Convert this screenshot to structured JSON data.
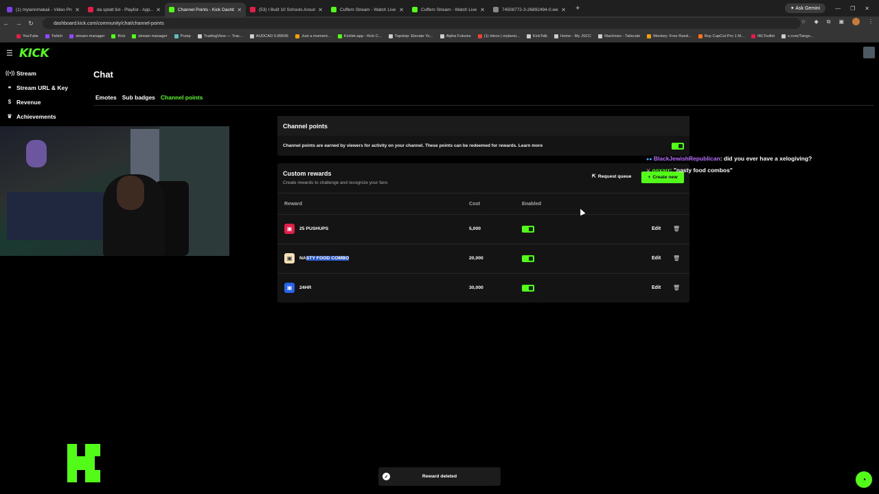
{
  "browser": {
    "tabs": [
      {
        "title": "(1) mylannmakaii - Video Prod...",
        "color": "#7b3fe4",
        "active": false
      },
      {
        "title": "da splatt list - Playlist - App...",
        "color": "#e11d48",
        "active": false
      },
      {
        "title": "Channel Points - Kick Dashbo...",
        "color": "#53fc18",
        "active": true
      },
      {
        "title": "(53) I Built 10 Schools Around...",
        "color": "#e11d48",
        "active": false
      },
      {
        "title": "Cuffem Stream - Watch Live o...",
        "color": "#53fc18",
        "active": false
      },
      {
        "title": "Cuffem Stream - Watch Live o...",
        "color": "#53fc18",
        "active": false
      },
      {
        "title": "74508772-3-26892494-0.webp",
        "color": "#888888",
        "active": false
      }
    ],
    "new_tab": "+",
    "ask_gemini": "Ask Gemini",
    "url": "dashboard.kick.com/community/chat/channel-points",
    "bookmarks": [
      {
        "label": "YouTube",
        "color": "#e11d48"
      },
      {
        "label": "Twitch",
        "color": "#9146ff"
      },
      {
        "label": "stream manager",
        "color": "#9146ff"
      },
      {
        "label": "Kick",
        "color": "#53fc18"
      },
      {
        "label": "stream manager",
        "color": "#53fc18"
      },
      {
        "label": "Pump",
        "color": "#5bc0be"
      },
      {
        "label": "TradingView — Trac...",
        "color": "#cccccc"
      },
      {
        "label": "AUDCAD 0.89596",
        "color": "#cccccc"
      },
      {
        "label": "Just a moment...",
        "color": "#f59e0b"
      },
      {
        "label": "Kicklet.app - Kick C...",
        "color": "#53fc18"
      },
      {
        "label": "Topstep: Elevate Yo...",
        "color": "#cccccc"
      },
      {
        "label": "Alpha Futures",
        "color": "#cccccc"
      },
      {
        "label": "(1) Inbox | mylansi...",
        "color": "#ea4335"
      },
      {
        "label": "KickTalk",
        "color": "#cccccc"
      },
      {
        "label": "Home - My JSCC",
        "color": "#cccccc"
      },
      {
        "label": "Machines - Tailscale",
        "color": "#cccccc"
      },
      {
        "label": "Monkey: Free Rand...",
        "color": "#f59e0b"
      },
      {
        "label": "Buy CapCut Pro 1 M...",
        "color": "#f97316"
      },
      {
        "label": "IRLToolkit",
        "color": "#e11d48"
      },
      {
        "label": "x.com/Tango...",
        "color": "#cccccc"
      }
    ]
  },
  "app": {
    "logo": "KICK"
  },
  "sidebar": {
    "items": [
      {
        "label": "Stream",
        "icon": "broadcast-icon"
      },
      {
        "label": "Stream URL & Key",
        "icon": "link-icon"
      },
      {
        "label": "Revenue",
        "icon": "dollar-icon"
      },
      {
        "label": "Achievements",
        "icon": "trophy-icon"
      }
    ]
  },
  "page": {
    "title": "Chat",
    "subtabs": [
      {
        "label": "Emotes",
        "active": false
      },
      {
        "label": "Sub badges",
        "active": false
      },
      {
        "label": "Channel points",
        "active": true
      }
    ]
  },
  "channel_points": {
    "title": "Channel points",
    "description": "Channel points are earned by viewers for activity on your channel. These points can be redeemed for rewards. Learn more",
    "enabled": true
  },
  "custom_rewards": {
    "title": "Custom rewards",
    "subtitle": "Create rewards to challenge and recognize your fans",
    "request_queue_label": "Request queue",
    "create_new_label": "Create new",
    "columns": {
      "reward": "Reward",
      "cost": "Cost",
      "enabled": "Enabled"
    },
    "rows": [
      {
        "name": "25 PUSHUPS",
        "cost": "5,000",
        "enabled": true,
        "icon_color": "#e11d48",
        "edit": "Edit"
      },
      {
        "name_prefix": "NA",
        "name_selected": "STY FOOD COMBO",
        "cost": "20,000",
        "enabled": true,
        "icon_color": "#f5e0b8",
        "edit": "Edit"
      },
      {
        "name": "24HR",
        "cost": "30,000",
        "enabled": true,
        "icon_color": "#2563eb",
        "edit": "Edit"
      }
    ]
  },
  "chat_overlay": {
    "messages": [
      {
        "user": "BlackJewishRepublican",
        "text": ": did you ever have a xelogiving?"
      },
      {
        "user": "osxarr",
        "text": ": \"nasty food combos\""
      }
    ]
  },
  "toast": {
    "message": "Reward deleted"
  },
  "colors": {
    "accent": "#53fc18",
    "background": "#000000",
    "card": "#141414"
  }
}
